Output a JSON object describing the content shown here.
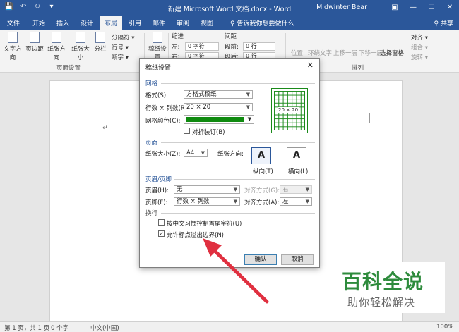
{
  "titlebar": {
    "quick_access": [
      "save-icon",
      "undo-icon",
      "redo-icon",
      "customize-icon"
    ],
    "title": "新建 Microsoft Word 文档.docx  -  Word",
    "user": "Midwinter Bear",
    "window_buttons": [
      "ribbon-options-icon",
      "minimize-icon",
      "maximize-icon",
      "close-icon"
    ]
  },
  "tabs": {
    "items": [
      "文件",
      "开始",
      "插入",
      "设计",
      "布局",
      "引用",
      "邮件",
      "审阅",
      "视图"
    ],
    "active": "布局",
    "tell_me": "♀ 告诉我你想要做什么",
    "share": "♀ 共享"
  },
  "ribbon": {
    "text_direction": "文字方向",
    "margins": "页边距",
    "orientation": "纸张方向",
    "size": "纸张大小",
    "columns": "分栏",
    "breaks": "分隔符 ▾",
    "line_numbers": "行号 ▾",
    "hyphenation": "断字 ▾",
    "page_setup_group": "页面设置",
    "draft_paper": "稿纸设置",
    "indent_header": "缩进",
    "spacing_header": "间距",
    "indent_left_label": "左:",
    "indent_left_value": "0 字符",
    "indent_right_label": "右:",
    "indent_right_value": "0 字符",
    "spacing_before_label": "段前:",
    "spacing_before_value": "0 行",
    "spacing_after_label": "段后:",
    "spacing_after_value": "0 行",
    "position": "位置",
    "wrap_text": "环绕文字",
    "bring_forward": "上移一层",
    "send_backward": "下移一层",
    "selection_pane": "选择窗格",
    "align": "对齐 ▾",
    "group_objects": "组合 ▾",
    "rotate": "旋转 ▾",
    "arrange_group": "排列"
  },
  "dialog": {
    "title": "稿纸设置",
    "close": "✕",
    "grid_section": "网格",
    "format_label": "格式(S):",
    "format_value": "方格式稿纸",
    "rows_cols_label": "行数 × 列数(R):",
    "rows_cols_value": "20 × 20",
    "grid_color_label": "网格颜色(C):",
    "grid_color": "#0f8a0f",
    "fold_label": "对折装订(B)",
    "preview_text": "20 × 20",
    "page_section": "页面",
    "paper_size_label": "纸张大小(Z):",
    "paper_size_value": "A4",
    "paper_orientation_label": "纸张方向:",
    "portrait_label": "纵向(T)",
    "landscape_label": "横向(L)",
    "header_footer_section": "页眉/页脚",
    "header_label": "页眉(H):",
    "header_value": "无",
    "header_align_label": "对齐方式(G):",
    "header_align_value": "右",
    "footer_label": "页脚(F):",
    "footer_value": "行数 × 列数",
    "footer_align_label": "对齐方式(A):",
    "footer_align_value": "左",
    "line_break_section": "换行",
    "check_chinese_rule": "按中文习惯控制首尾字符(U)",
    "check_allow_punct": "允许标点溢出边界(N)",
    "ok": "确认",
    "cancel": "取消"
  },
  "statusbar": {
    "page": "第 1 页，共 1 页",
    "words": "0 个字",
    "language": "中文(中国)",
    "zoom": "100%"
  },
  "watermark": {
    "line1": "百科全说",
    "line2": "助你轻松解决"
  },
  "annotation": {
    "arrow_color": "#e03040"
  }
}
